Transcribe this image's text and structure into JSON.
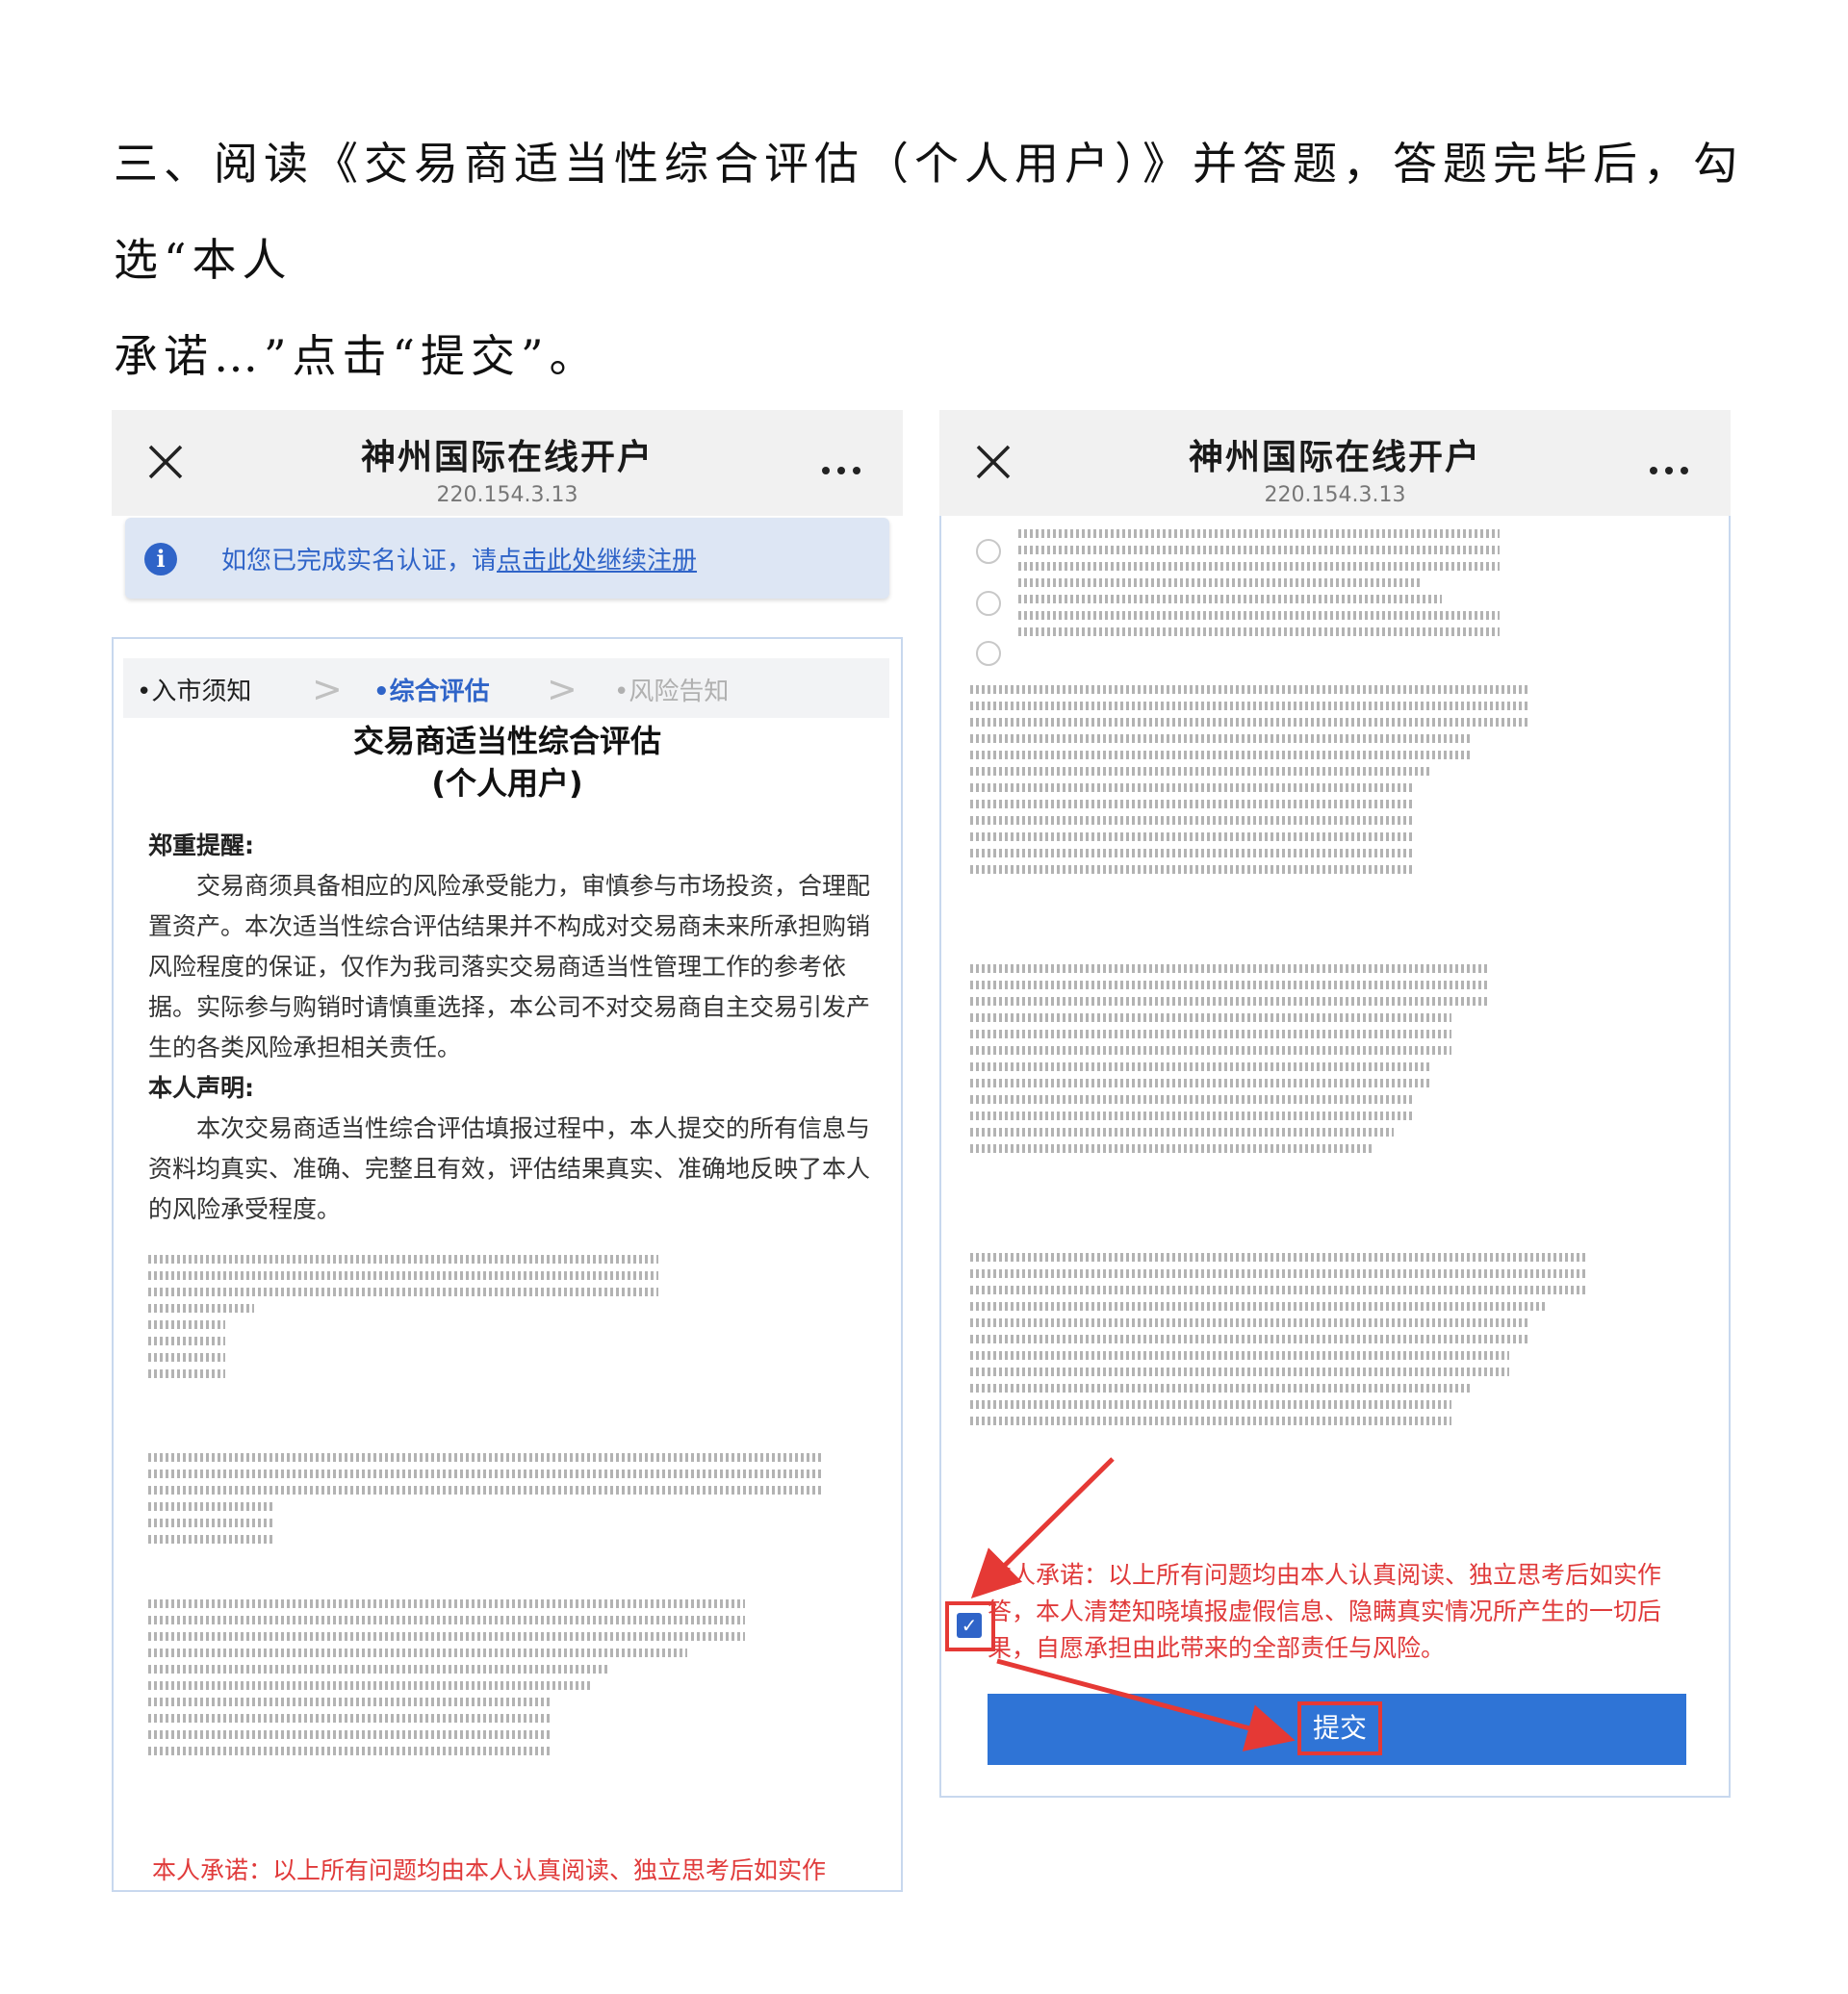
{
  "instruction": {
    "line1": "三、阅读《交易商适当性综合评估（个人用户）》并答题，答题完毕后，勾选“本人",
    "line2": "承诺…”点击“提交”。"
  },
  "app": {
    "title": "神州国际在线开户",
    "url": "220.154.3.13"
  },
  "notice": {
    "prefix": "如您已完成实名认证，请",
    "link": "点击此处继续注册"
  },
  "steps": [
    {
      "label": "入市须知"
    },
    {
      "label": "综合评估"
    },
    {
      "label": "风险告知"
    }
  ],
  "form": {
    "title_line1": "交易商适当性综合评估",
    "title_line2": "(个人用户)",
    "reminder_heading": "郑重提醒:",
    "reminder_body": "交易商须具备相应的风险承受能力，审慎参与市场投资，合理配置资产。本次适当性综合评估结果并不构成对交易商未来所承担购销风险程度的保证，仅作为我司落实交易商适当性管理工作的参考依据。实际参与购销时请慎重选择，本公司不对交易商自主交易引发产生的各类风险承担相关责任。",
    "statement_heading": "本人声明:",
    "statement_body": "本次交易商适当性综合评估填报过程中，本人提交的所有信息与资料均真实、准确、完整且有效，评估结果真实、准确地反映了本人的风险承受程度。",
    "pledge_partial": "本人承诺：以上所有问题均由本人认真阅读、独立思考后如实作"
  },
  "right": {
    "pledge": "本人承诺：以上所有问题均由本人认真阅读、独立思考后如实作答，本人清楚知晓填报虚假信息、隐瞒真实情况所产生的一切后果，自愿承担由此带来的全部责任与风险。",
    "checkbox_checked": true,
    "submit": "提交"
  },
  "colors": {
    "accent": "#2f64c8",
    "button": "#2f74d6",
    "warning": "#e03a3a",
    "highlight": "#e53935"
  }
}
